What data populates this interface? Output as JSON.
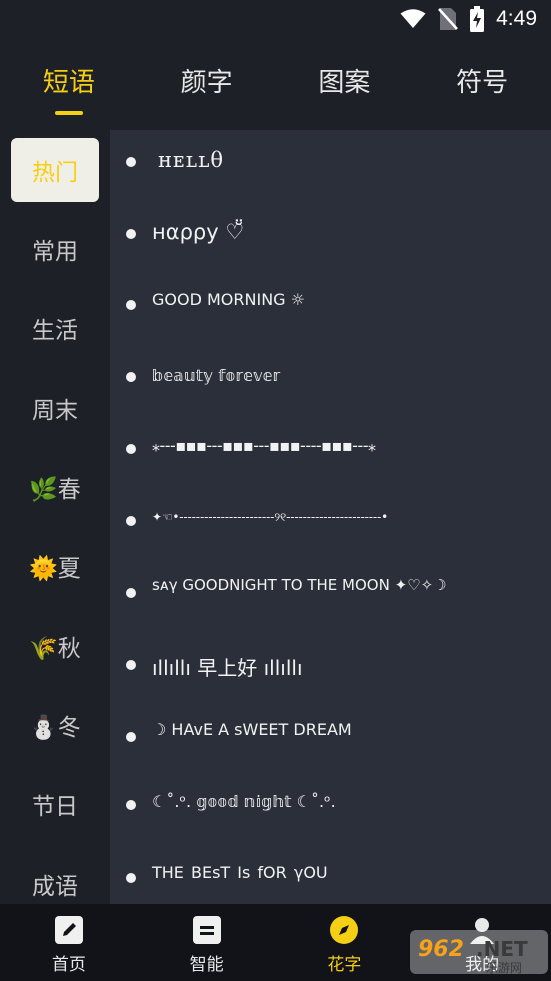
{
  "status_bar": {
    "time": "4:49",
    "icons": [
      "wifi-icon",
      "no-sim-icon",
      "battery-charging-icon"
    ]
  },
  "top_tabs": [
    {
      "label": "短语",
      "active": true
    },
    {
      "label": "颜字",
      "active": false
    },
    {
      "label": "图案",
      "active": false
    },
    {
      "label": "符号",
      "active": false
    }
  ],
  "sidebar": {
    "items": [
      {
        "label": "热门",
        "active": true
      },
      {
        "label": "常用",
        "active": false
      },
      {
        "label": "生活",
        "active": false
      },
      {
        "label": "周末",
        "active": false
      },
      {
        "label": "🌿春",
        "active": false
      },
      {
        "label": "🌞夏",
        "active": false
      },
      {
        "label": "🌾秋",
        "active": false
      },
      {
        "label": "⛄冬",
        "active": false
      },
      {
        "label": "节日",
        "active": false
      },
      {
        "label": "成语",
        "active": false
      }
    ]
  },
  "phrases": [
    "ʜᴇʟʟθ",
    "нαρρу ♡̆̈",
    "GOOD MORNING ☼",
    "𝕓𝕖𝕒𝕦𝕥𝕪 𝕗𝕠𝕣𝕖𝕧𝕖𝕣",
    "⁎---▪▪▪---▪▪▪---▪▪▪----▪▪▪---⁎",
    "✦☜•-----------------------୨୧-----------------------•",
    "sᴀγ GOODNIGHT TO THE MOON ✦♡✧☽",
    "ıllıllı 早上好 ıllıllı",
    "☽ HAvE A sWEET DREAM",
    "☾˚.ᵒ. 𝕘𝕠𝕠𝕕 𝕟𝕚𝕘𝕙𝕥 ☾˚.ᵒ.",
    "THE  BEsT  Is  fOR  γOU"
  ],
  "bottom_nav": [
    {
      "label": "首页",
      "icon": "pencil-icon",
      "active": false
    },
    {
      "label": "智能",
      "icon": "equals-icon",
      "active": false
    },
    {
      "label": "花字",
      "icon": "compass-icon",
      "active": true
    },
    {
      "label": "我的",
      "icon": "user-icon",
      "active": false
    }
  ],
  "watermark": {
    "text": "962.NET",
    "subtext": "乐游网"
  },
  "colors": {
    "accent": "#f5cf14",
    "background": "#1e2027",
    "panel": "#2b2f39",
    "nav": "#121319"
  }
}
